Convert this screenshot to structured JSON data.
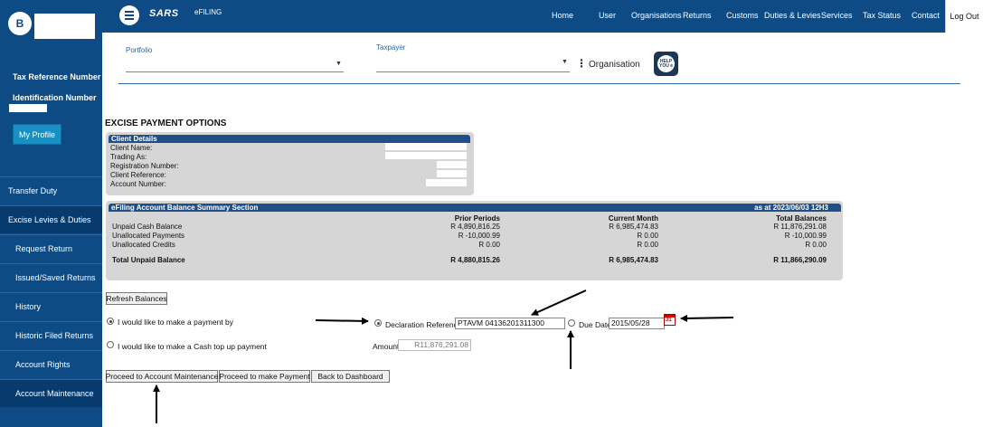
{
  "sidebar": {
    "avatar_initial": "B",
    "tax_reference_label": "Tax Reference Number",
    "identification_label": "Identification Number",
    "profile_button": "My Profile",
    "items": [
      {
        "label": "Transfer Duty"
      },
      {
        "label": "Excise Levies & Duties"
      },
      {
        "label": "Request Return"
      },
      {
        "label": "Issued/Saved Returns"
      },
      {
        "label": "History"
      },
      {
        "label": "Historic Filed Returns"
      },
      {
        "label": "Account Rights"
      },
      {
        "label": "Account Maintenance"
      }
    ]
  },
  "topnav": {
    "logo": "SARS",
    "efiling": "eFILING",
    "items": [
      "Home",
      "User",
      "Organisations",
      "Returns",
      "Customs",
      "Duties & Levies",
      "Services",
      "Tax Status",
      "Contact"
    ],
    "logout": "Log Out"
  },
  "selectors": {
    "portfolio_label": "Portfolio",
    "taxpayer_label": "Taxpayer",
    "organisation_label": "Organisation",
    "help_icon_text": "HELP YOU e"
  },
  "page_title": "EXCISE PAYMENT OPTIONS",
  "client_details": {
    "header": "Client Details",
    "rows": [
      "Client Name:",
      "Trading As:",
      "Registration Number:",
      "Client Reference:",
      "Account Number:"
    ]
  },
  "balance_summary": {
    "header": "eFiling Account Balance Summary Section",
    "as_at": "as at 2023/06/03 12H3",
    "columns": [
      "Prior Periods",
      "Current Month",
      "Total Balances"
    ],
    "rows": [
      {
        "label": "Unpaid Cash Balance",
        "prior": "R 4,890,816.25",
        "current": "R 6,985,474.83",
        "total": "R 11,876,291.08"
      },
      {
        "label": "Unallocated Payments",
        "prior": "R -10,000.99",
        "current": "R 0.00",
        "total": "R -10,000.99"
      },
      {
        "label": "Unallocated Credits",
        "prior": "R 0.00",
        "current": "R 0.00",
        "total": "R 0.00"
      }
    ],
    "total_row": {
      "label": "Total Unpaid Balance",
      "prior": "R 4,880,815.26",
      "current": "R 6,985,474.83",
      "total": "R 11,866,290.09"
    }
  },
  "refresh_button": "Refresh Balances",
  "payment_options": {
    "option1": "I would like to make a payment by",
    "option2": "I would like to make a Cash top up payment",
    "declaration_label": "Declaration Reference",
    "declaration_value": "PTAVM 04136201311300",
    "due_date_label": "Due Date",
    "due_date_value": "2015/05/28",
    "calendar_icon_text": "31",
    "amount_label": "Amount",
    "amount_value": "R11,876,291.08"
  },
  "actions": {
    "maintenance": "Proceed to Account Maintenance",
    "payment": "Proceed to make Payment",
    "dashboard": "Back to Dashboard"
  }
}
